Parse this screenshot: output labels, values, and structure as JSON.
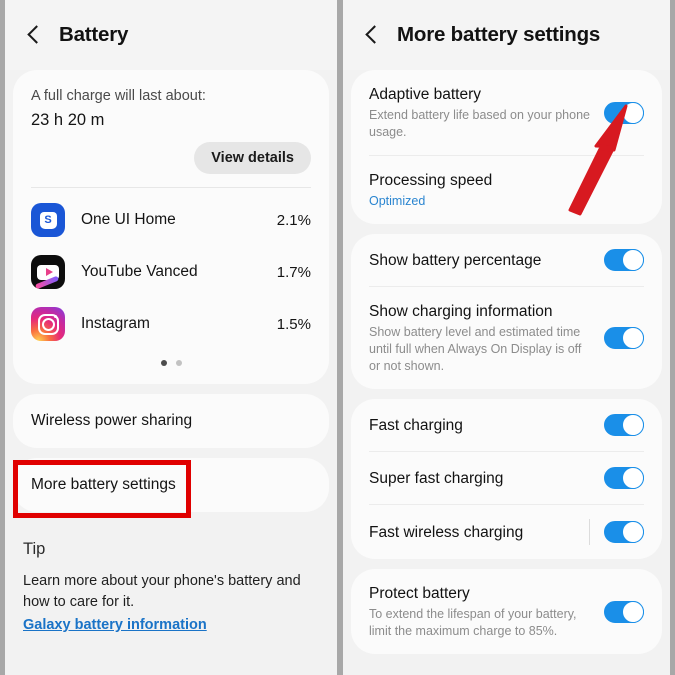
{
  "left_screen": {
    "header": {
      "title": "Battery",
      "back_icon": "back-chevron-icon"
    },
    "summary": {
      "label": "A full charge will last about:",
      "value": "23 h 20 m",
      "button": "View details"
    },
    "apps": [
      {
        "icon": "one-ui-home-icon",
        "name": "One UI Home",
        "usage": "2.1%"
      },
      {
        "icon": "youtube-vanced-icon",
        "name": "YouTube Vanced",
        "usage": "1.7%"
      },
      {
        "icon": "instagram-icon",
        "name": "Instagram",
        "usage": "1.5%"
      }
    ],
    "pager": {
      "total": 2,
      "active": 1
    },
    "rows": [
      {
        "label": "Wireless power sharing"
      },
      {
        "label": "More battery settings"
      }
    ],
    "tip": {
      "title": "Tip",
      "body": "Learn more about your phone's battery and how to care for it.",
      "link": "Galaxy battery information"
    }
  },
  "right_screen": {
    "header": {
      "title": "More battery settings",
      "back_icon": "back-chevron-icon"
    },
    "groups": [
      {
        "rows": [
          {
            "title": "Adaptive battery",
            "subtitle": "Extend battery life based on your phone usage.",
            "control": "toggle",
            "state": "on"
          },
          {
            "title": "Processing speed",
            "subtitle": "Optimized",
            "subtitle_style": "blue",
            "control": "none"
          }
        ]
      },
      {
        "rows": [
          {
            "title": "Show battery percentage",
            "subtitle": "",
            "control": "toggle",
            "state": "on"
          },
          {
            "title": "Show charging information",
            "subtitle": "Show battery level and estimated time until full when Always On Display is off or not shown.",
            "control": "toggle",
            "state": "on"
          }
        ]
      },
      {
        "rows": [
          {
            "title": "Fast charging",
            "subtitle": "",
            "control": "toggle",
            "state": "on"
          },
          {
            "title": "Super fast charging",
            "subtitle": "",
            "control": "toggle",
            "state": "on"
          },
          {
            "title": "Fast wireless charging",
            "subtitle": "",
            "control": "toggle",
            "state": "on",
            "has_divider": true
          }
        ]
      },
      {
        "rows": [
          {
            "title": "Protect battery",
            "subtitle": "To extend the lifespan of your battery, limit the maximum charge to 85%.",
            "control": "toggle",
            "state": "on"
          }
        ]
      }
    ]
  },
  "annotations": {
    "highlight_box": {
      "target": "More battery settings",
      "color": "#e00000"
    },
    "arrow": {
      "target": "Adaptive battery toggle",
      "color": "#d71920"
    }
  },
  "colors": {
    "accent_blue": "#1a8fe8",
    "link_blue": "#1a73c7",
    "annotation_red": "#e00000",
    "page_bg": "#f2f2f2",
    "card_bg": "#fbfbfb"
  }
}
